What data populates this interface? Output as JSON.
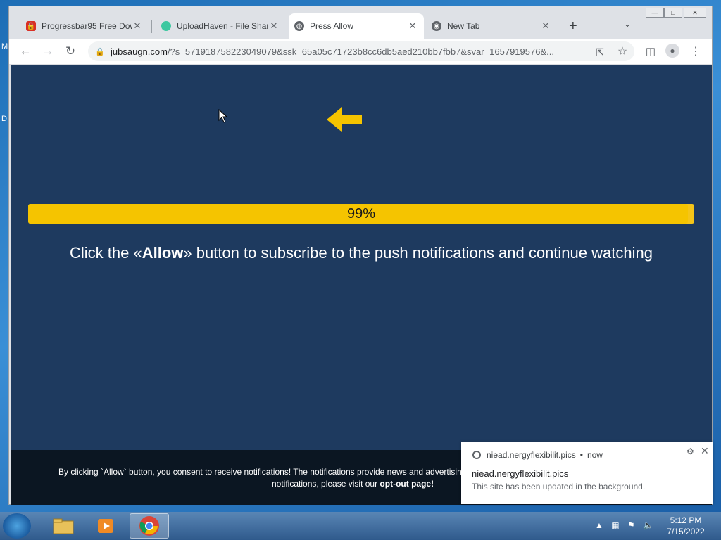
{
  "desktop": {
    "side_letters": [
      "M",
      "D"
    ]
  },
  "browser": {
    "tabs": [
      {
        "title": "Progressbar95 Free Dow",
        "icon": "lock-red-icon",
        "active": false
      },
      {
        "title": "UploadHaven - File Shar",
        "icon": "uploadhaven-icon",
        "active": false
      },
      {
        "title": "Press Allow",
        "icon": "globe-icon",
        "active": true
      },
      {
        "title": "New Tab",
        "icon": "chrome-icon",
        "active": false
      }
    ],
    "new_tab_label": "+",
    "tab_close": "✕",
    "url_domain": "jubsaugn.com",
    "url_rest": "/?s=571918758223049079&ssk=65a05c71723b8cc6db5aed210bb7fbb7&svar=1657919576&..."
  },
  "page": {
    "progress_label": "99%",
    "progress_value": 0.99,
    "headline_pre": "Click the «",
    "headline_bold": "Allow",
    "headline_post": "» button to subscribe to the push notifications and continue watching",
    "footer_line1": "By clicking `Allow` button, you consent to receive notifications! The notifications provide news and advertisin",
    "footer_line2_pre": "notifications, please visit our ",
    "footer_line2_bold": "opt-out page!",
    "accent_color": "#f5c400",
    "background_color": "#1e3a5f"
  },
  "notification": {
    "source": "niead.nergyflexibilit.pics",
    "time": "now",
    "separator": "•",
    "title": "niead.nergyflexibilit.pics",
    "body": "This site has been updated in the background."
  },
  "taskbar": {
    "time": "5:12 PM",
    "date": "7/15/2022"
  }
}
